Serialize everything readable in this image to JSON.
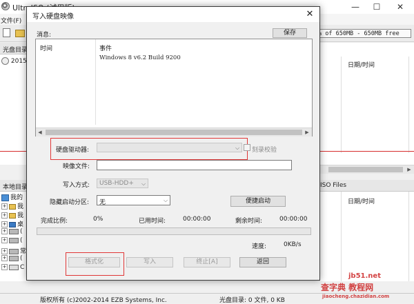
{
  "main_window": {
    "title": "UltraISO (试用版)",
    "menu_file": "文件(F)",
    "capacity_text": "% of 650MB - 650MB free",
    "cd_dir_label": "光盘目录",
    "tree_item": "2015",
    "datetime_col_top": "日期/时间",
    "local_dir_label": "本地目录",
    "iso_files_label": "ISO Files",
    "datetime_col_bottom": "日期/时间",
    "local_tree": [
      "我的",
      "我",
      "我",
      "桌",
      "(",
      "(",
      "常",
      "(",
      "C"
    ],
    "status_copyright": "版权所有 (c)2002-2014 EZB Systems, Inc.",
    "status_cd": "光盘目录: 0 文件, 0 KB",
    "window_controls": {
      "minimize": "—",
      "maximize": "☐",
      "close": "✕"
    }
  },
  "watermark": {
    "line1": "查字典 教程网",
    "line2": "jb51.net",
    "line3": "jiaocheng.chazidian.com"
  },
  "dialog": {
    "title": "写入硬盘映像",
    "close": "✕",
    "messages_label": "消息:",
    "save_button": "保存",
    "log_columns": {
      "time": "时间",
      "event": "事件"
    },
    "log_entries": [
      {
        "time": "",
        "event": "Windows 8 v6.2 Build 9200"
      }
    ],
    "disk_drive_label": "硬盘驱动器:",
    "disk_drive_value": "",
    "verify_label": "刻录校验",
    "image_file_label": "映像文件:",
    "image_file_value": "",
    "write_method_label": "写入方式:",
    "write_method_value": "USB-HDD+",
    "hidden_partition_label": "隐藏启动分区:",
    "hidden_partition_value": "无",
    "convenient_boot_button": "便捷启动",
    "completed_label": "完成比例:",
    "completed_value": "0%",
    "elapsed_label": "已用时间:",
    "elapsed_value": "00:00:00",
    "remaining_label": "剩余时间:",
    "remaining_value": "00:00:00",
    "progress": 0,
    "speed_label": "速度:",
    "speed_value": "0KB/s",
    "buttons": {
      "format": "格式化",
      "write": "写入",
      "stop": "终止[A]",
      "back": "返回"
    }
  },
  "colors": {
    "annotation_red": "#e03535",
    "dialog_bg": "#f0f0f0"
  }
}
